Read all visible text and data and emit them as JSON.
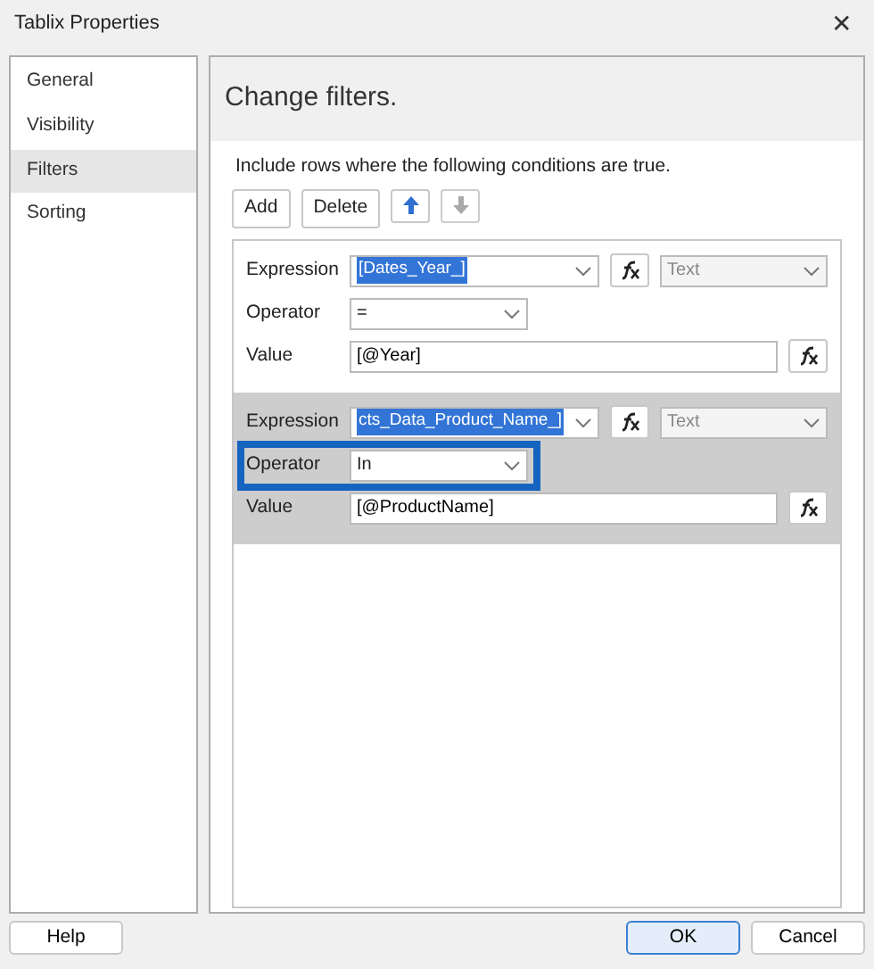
{
  "window": {
    "title": "Tablix Properties",
    "close": "✕"
  },
  "sidebar": {
    "items": [
      {
        "label": "General",
        "selected": false
      },
      {
        "label": "Visibility",
        "selected": false
      },
      {
        "label": "Filters",
        "selected": true
      },
      {
        "label": "Sorting",
        "selected": false
      }
    ]
  },
  "header": "Change filters.",
  "instructions": "Include rows where the following conditions are true.",
  "toolbar": {
    "add": "Add",
    "delete": "Delete",
    "move_up_disabled": false,
    "move_down_disabled": true
  },
  "filters": [
    {
      "selected": false,
      "expression_label": "Expression",
      "expression": "[Dates_Year_]",
      "type": "Text",
      "operator_label": "Operator",
      "operator": "=",
      "operator_highlighted": false,
      "value_label": "Value",
      "value": "[@Year]"
    },
    {
      "selected": true,
      "expression_label": "Expression",
      "expression": "cts_Data_Product_Name_]",
      "type": "Text",
      "operator_label": "Operator",
      "operator": "In",
      "operator_highlighted": true,
      "value_label": "Value",
      "value": "[@ProductName]"
    }
  ],
  "buttons": {
    "help": "Help",
    "ok": "OK",
    "cancel": "Cancel"
  }
}
